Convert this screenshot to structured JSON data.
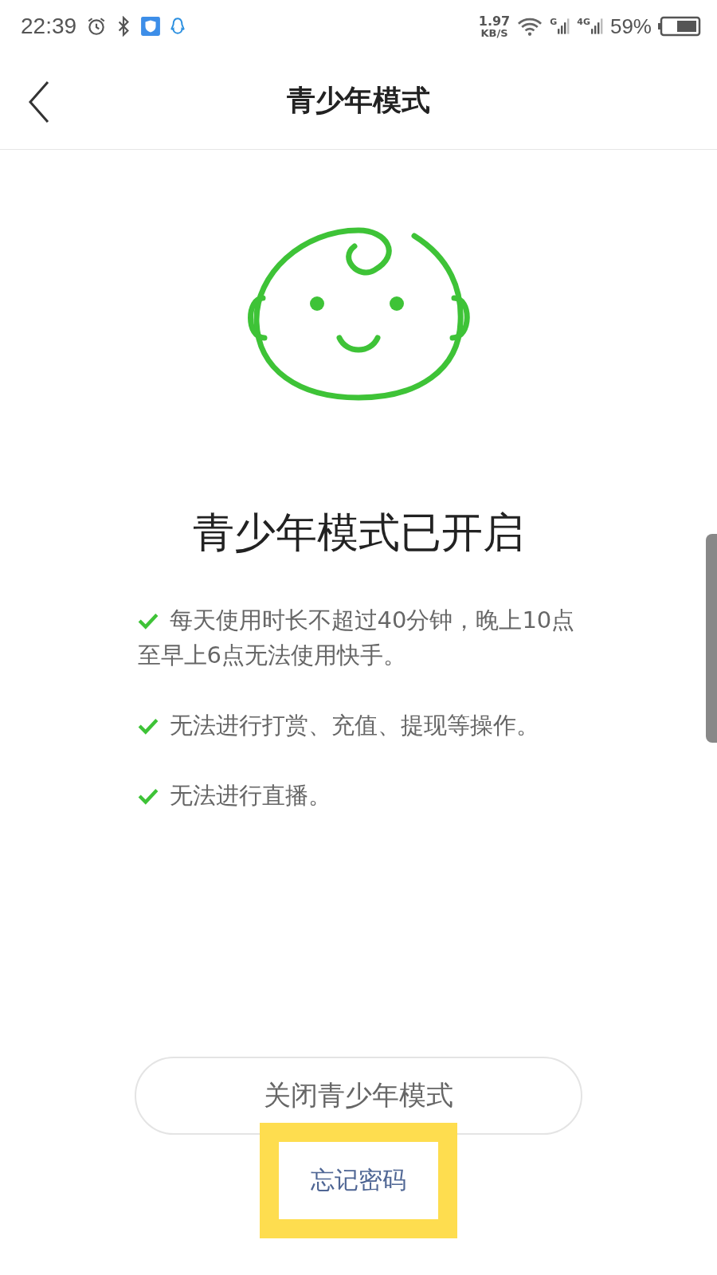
{
  "status_bar": {
    "time": "22:39",
    "speed_value": "1.97",
    "speed_unit": "KB/S",
    "network_1": "G",
    "network_2": "4G",
    "battery": "59%"
  },
  "header": {
    "title": "青少年模式"
  },
  "main": {
    "heading": "青少年模式已开启",
    "rules": [
      {
        "text": "每天使用时长不超过40分钟，晚上10点至早上6点无法使用快手。"
      },
      {
        "text": "无法进行打赏、充值、提现等操作。"
      },
      {
        "text": "无法进行直播。"
      }
    ]
  },
  "close_button": {
    "label": "关闭青少年模式"
  },
  "forgot_link": {
    "label": "忘记密码",
    "highlighted": true
  }
}
